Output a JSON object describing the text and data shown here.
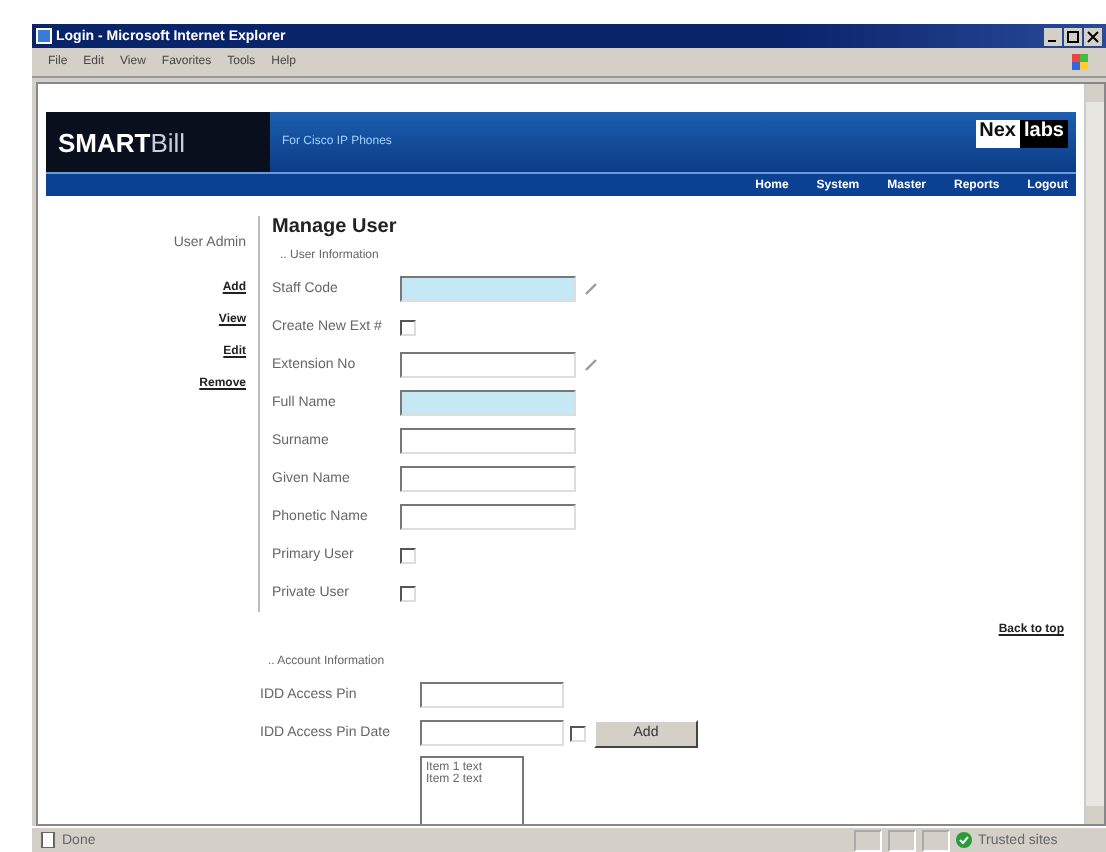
{
  "window": {
    "title": "Login - Microsoft Internet Explorer"
  },
  "menu": [
    "File",
    "Edit",
    "View",
    "Favorites",
    "Tools",
    "Help"
  ],
  "header": {
    "logo_bold": "SMART",
    "logo_light": "Bill",
    "tagline": "For Cisco IP Phones",
    "brand_left": "Nex",
    "brand_right": "labs"
  },
  "nav": [
    "Home",
    "System",
    "Master",
    "Reports",
    "Logout"
  ],
  "sidebar": {
    "title": "User Admin",
    "links": [
      "Add",
      "View",
      "Edit",
      "Remove"
    ]
  },
  "page_title": "Manage User",
  "user_section": {
    "title": ".. User Information",
    "fields": [
      {
        "label": "Staff Code",
        "kind": "text",
        "highlighted": true,
        "lookup": true
      },
      {
        "label": "Create New Ext #",
        "kind": "checkbox",
        "checked": false
      },
      {
        "label": "Extension No",
        "kind": "text",
        "highlighted": false,
        "lookup": true
      },
      {
        "label": "Full Name",
        "kind": "text",
        "highlighted": true,
        "lookup": false
      },
      {
        "label": "Surname",
        "kind": "text",
        "highlighted": false,
        "lookup": false
      },
      {
        "label": "Given Name",
        "kind": "text",
        "highlighted": false,
        "lookup": false
      },
      {
        "label": "Phonetic Name",
        "kind": "text",
        "highlighted": false,
        "lookup": false
      },
      {
        "label": "Primary User",
        "kind": "checkbox",
        "checked": false
      },
      {
        "label": "Private User",
        "kind": "checkbox",
        "checked": false
      }
    ]
  },
  "back_to_top": "Back to top",
  "account_section": {
    "title": ".. Account Information",
    "pin_label": "IDD Access Pin",
    "pin_date_label": "IDD Access Pin Date",
    "date_checked": false,
    "add_button": "Add",
    "list_items": [
      "Item 1 text",
      "Item 2 text"
    ]
  },
  "status_bar": {
    "status": "Done",
    "zone": "Trusted sites"
  }
}
